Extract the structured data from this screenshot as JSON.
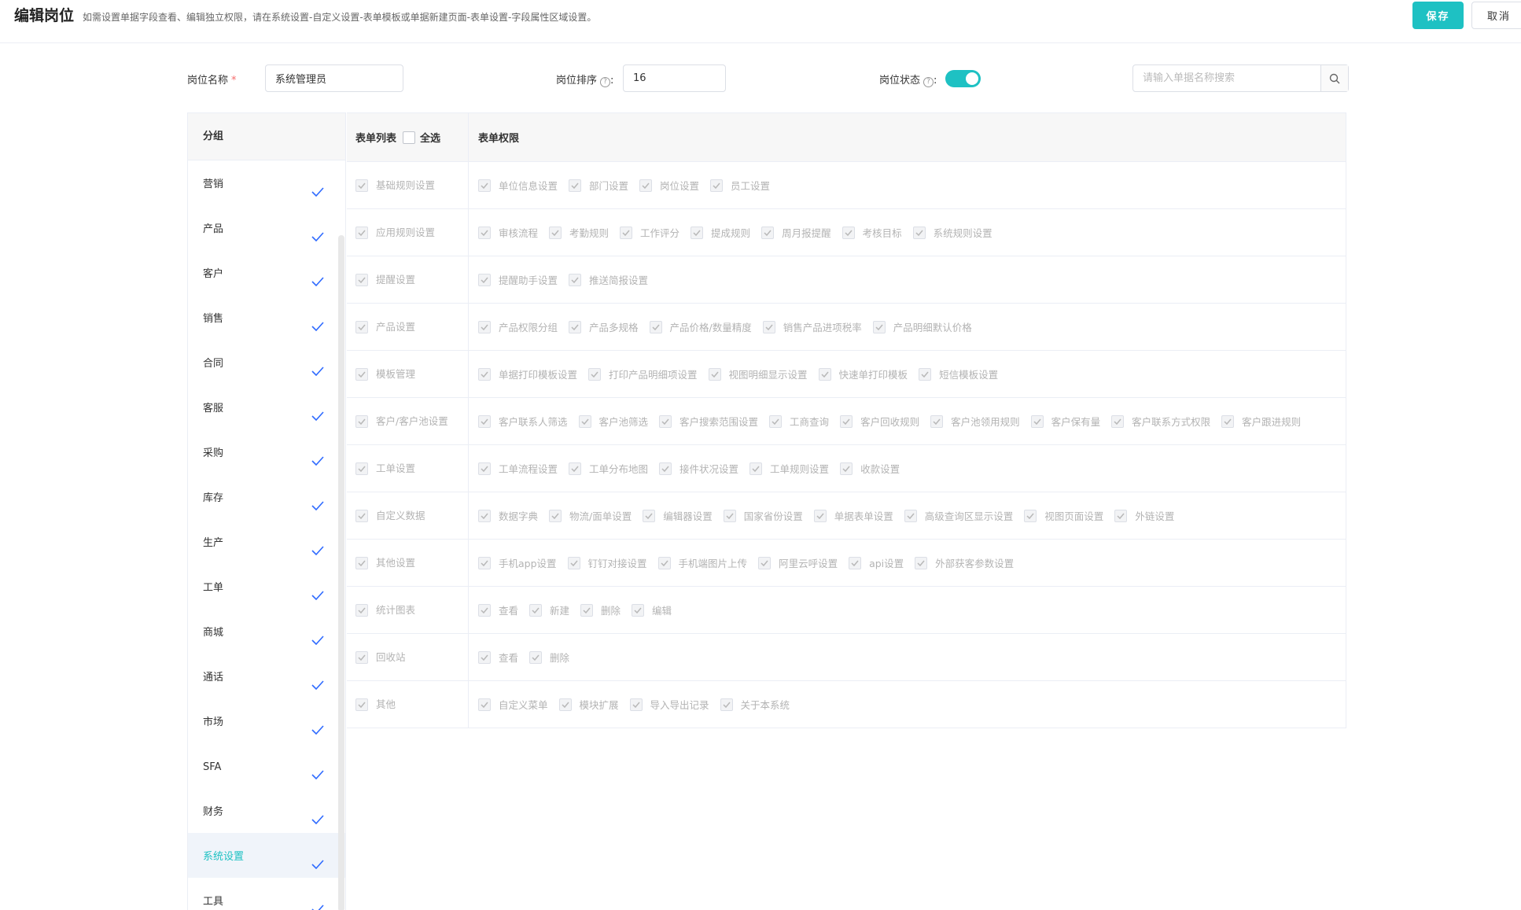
{
  "header": {
    "title": "编辑岗位",
    "subtitle": "如需设置单据字段查看、编辑独立权限，请在系统设置-自定义设置-表单模板或单据新建页面-表单设置-字段属性区域设置。",
    "save_label": "保存",
    "cancel_label": "取消"
  },
  "form": {
    "name_label": "岗位名称",
    "name_required_mark": "*",
    "name_value": "系统管理员",
    "sort_label": "岗位排序",
    "sort_value": "16",
    "status_label": "岗位状态",
    "status_on": true,
    "search_placeholder": "请输入单据名称搜索"
  },
  "sidebar": {
    "header": "分组",
    "items": [
      {
        "label": "营销"
      },
      {
        "label": "产品"
      },
      {
        "label": "客户"
      },
      {
        "label": "销售"
      },
      {
        "label": "合同"
      },
      {
        "label": "客服"
      },
      {
        "label": "采购"
      },
      {
        "label": "库存"
      },
      {
        "label": "生产"
      },
      {
        "label": "工单"
      },
      {
        "label": "商城"
      },
      {
        "label": "通话"
      },
      {
        "label": "市场"
      },
      {
        "label": "SFA"
      },
      {
        "label": "财务"
      },
      {
        "label": "系统设置",
        "active": true
      },
      {
        "label": "工具"
      }
    ]
  },
  "table": {
    "col_list": "表单列表",
    "select_all": "全选",
    "col_perm": "表单权限",
    "rows": [
      {
        "name": "基础规则设置",
        "perms": [
          "单位信息设置",
          "部门设置",
          "岗位设置",
          "员工设置"
        ]
      },
      {
        "name": "应用规则设置",
        "perms": [
          "审核流程",
          "考勤规则",
          "工作评分",
          "提成规则",
          "周月报提醒",
          "考核目标",
          "系统规则设置"
        ]
      },
      {
        "name": "提醒设置",
        "perms": [
          "提醒助手设置",
          "推送简报设置"
        ]
      },
      {
        "name": "产品设置",
        "perms": [
          "产品权限分组",
          "产品多规格",
          "产品价格/数量精度",
          "销售产品进项税率",
          "产品明细默认价格"
        ]
      },
      {
        "name": "模板管理",
        "perms": [
          "单据打印模板设置",
          "打印产品明细项设置",
          "视图明细显示设置",
          "快速单打印模板",
          "短信模板设置"
        ]
      },
      {
        "name": "客户/客户池设置",
        "perms": [
          "客户联系人筛选",
          "客户池筛选",
          "客户搜索范围设置",
          "工商查询",
          "客户回收规则",
          "客户池领用规则",
          "客户保有量",
          "客户联系方式权限",
          "客户跟进规则"
        ]
      },
      {
        "name": "工单设置",
        "perms": [
          "工单流程设置",
          "工单分布地图",
          "接件状况设置",
          "工单规则设置",
          "收款设置"
        ]
      },
      {
        "name": "自定义数据",
        "perms": [
          "数据字典",
          "物流/面单设置",
          "编辑器设置",
          "国家省份设置",
          "单据表单设置",
          "高级查询区显示设置",
          "视图页面设置",
          "外链设置"
        ]
      },
      {
        "name": "其他设置",
        "perms": [
          "手机app设置",
          "钉钉对接设置",
          "手机端图片上传",
          "阿里云呼设置",
          "api设置",
          "外部获客参数设置"
        ]
      },
      {
        "name": "统计图表",
        "perms": [
          "查看",
          "新建",
          "删除",
          "编辑"
        ]
      },
      {
        "name": "回收站",
        "perms": [
          "查看",
          "删除"
        ]
      },
      {
        "name": "其他",
        "perms": [
          "自定义菜单",
          "模块扩展",
          "导入导出记录",
          "关于本系统"
        ]
      }
    ]
  },
  "colors": {
    "accent": "#1ec1c3",
    "check": "#2f6bff",
    "disabled_text": "#b3b3b3"
  },
  "icons": {
    "side_check": "check-icon",
    "search": "search-icon",
    "help": "help-circle-icon"
  }
}
